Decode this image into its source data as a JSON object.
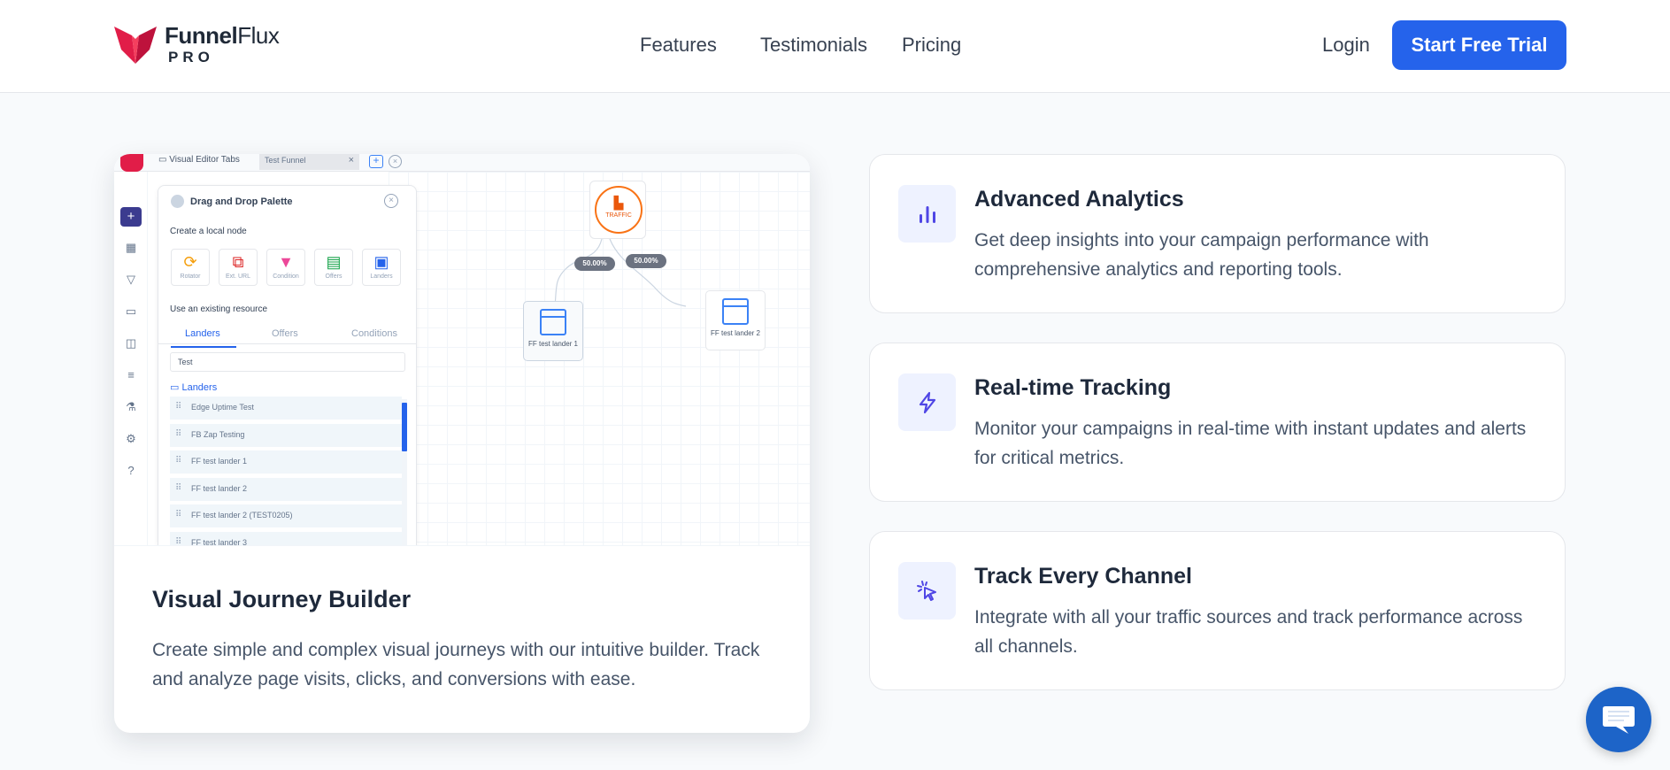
{
  "header": {
    "brand_bold": "Funnel",
    "brand_light": "Flux",
    "brand_sub": "PRO",
    "nav": [
      "Features",
      "Testimonials",
      "Pricing"
    ],
    "login": "Login",
    "cta": "Start Free Trial"
  },
  "builder": {
    "title": "Visual Journey Builder",
    "description": "Create simple and complex visual journeys with our intuitive builder. Track and analyze page visits, clicks, and conversions with ease.",
    "screenshot": {
      "tab1": "Visual Editor Tabs",
      "tab2": "Test Funnel",
      "palette_title": "Drag and Drop Palette",
      "create_local": "Create a local node",
      "nodes": [
        {
          "label": "Rotator",
          "icon": "rotator-icon",
          "color": "#f59e0b"
        },
        {
          "label": "Ext. URL",
          "icon": "external-url-icon",
          "color": "#dc2626"
        },
        {
          "label": "Condition",
          "icon": "condition-icon",
          "color": "#ec4899"
        },
        {
          "label": "Offers",
          "icon": "offers-icon",
          "color": "#16a34a"
        },
        {
          "label": "Landers",
          "icon": "landers-icon",
          "color": "#2563eb"
        }
      ],
      "use_existing": "Use an existing resource",
      "resource_tabs": [
        "Landers",
        "Offers",
        "Conditions"
      ],
      "search_value": "Test",
      "category": "Landers",
      "items": [
        "Edge Uptime Test",
        "FB Zap Testing",
        "FF test lander 1",
        "FF test lander 2",
        "FF test lander 2 (TEST0205)",
        "FF test lander 3"
      ],
      "traffic_label": "TRAFFIC",
      "pct_left": "50.00%",
      "pct_right": "50.00%",
      "lander1": "FF test lander 1",
      "lander2": "FF test lander 2"
    }
  },
  "features": [
    {
      "icon": "bar-chart-icon",
      "title": "Advanced Analytics",
      "description": "Get deep insights into your campaign performance with comprehensive analytics and reporting tools."
    },
    {
      "icon": "lightning-icon",
      "title": "Real-time Tracking",
      "description": "Monitor your campaigns in real-time with instant updates and alerts for critical metrics."
    },
    {
      "icon": "cursor-click-icon",
      "title": "Track Every Channel",
      "description": "Integrate with all your traffic sources and track performance across all channels."
    }
  ],
  "colors": {
    "primary": "#2563eb",
    "accent_icon": "#4f46e5",
    "brand": "#e11d48"
  }
}
